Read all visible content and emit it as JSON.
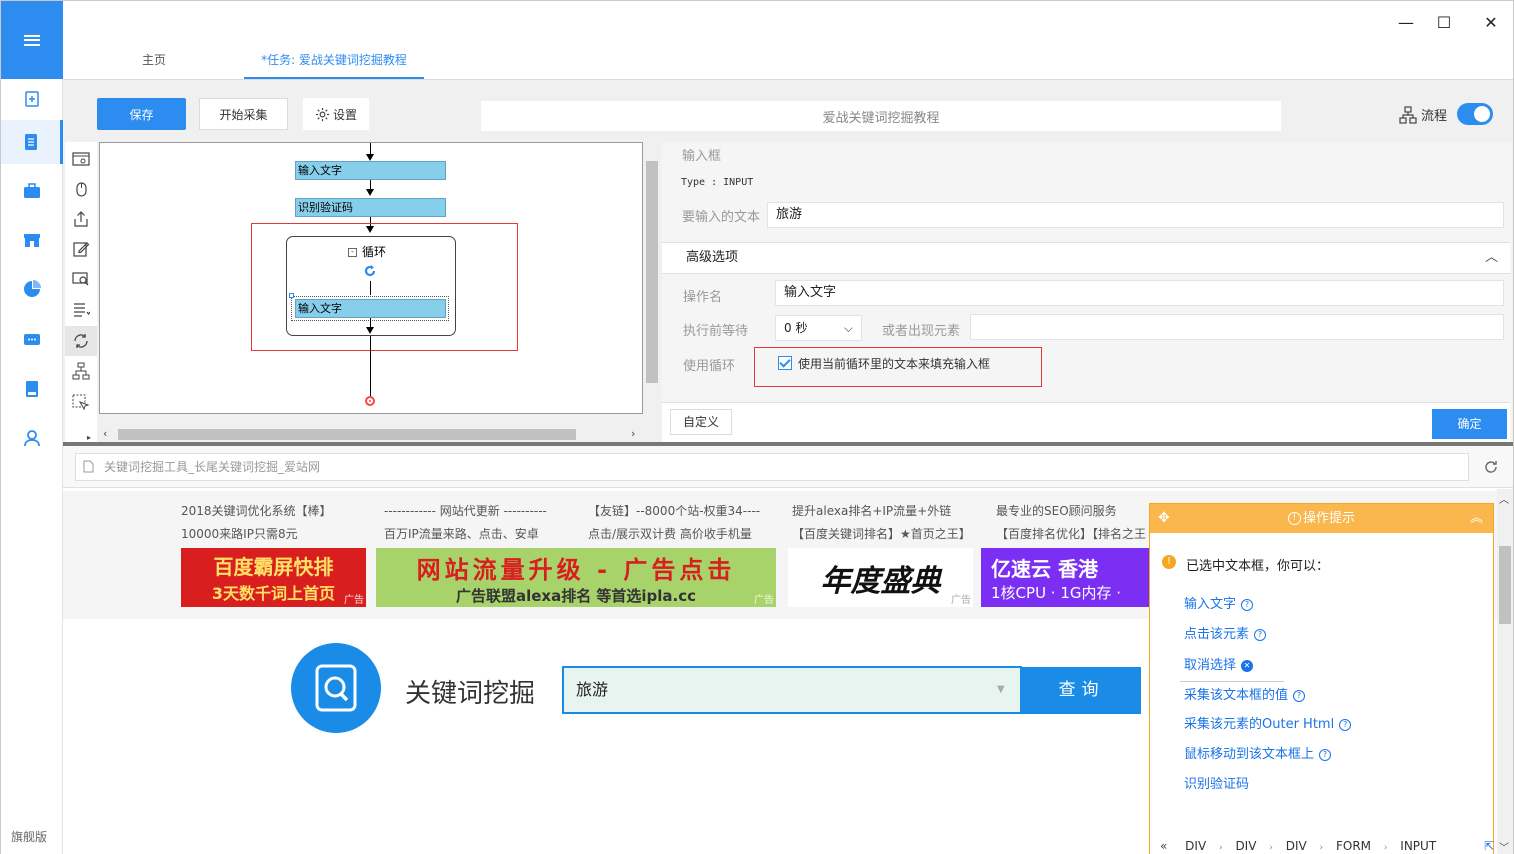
{
  "nav": {
    "edition": "旗舰版"
  },
  "window": {
    "minimize": "—",
    "maximize": "☐",
    "close": "✕"
  },
  "tabs": {
    "home": "主页",
    "task": "*任务: 爱战关键词挖掘教程"
  },
  "toolbar": {
    "save": "保存",
    "start": "开始采集",
    "settings": "设置",
    "task_title": "爱战关键词挖掘教程",
    "flow_label": "流程",
    "flow_enabled": true
  },
  "flow": {
    "node1": "输入文字",
    "node2": "识别验证码",
    "loop_title": "循环",
    "loop_node": "输入文字"
  },
  "props": {
    "section_title": "输入框",
    "type_line": "Type : INPUT",
    "text_label": "要输入的文本",
    "text_value": "旅游",
    "advanced": "高级选项",
    "op_name_label": "操作名",
    "op_name_value": "输入文字",
    "wait_label": "执行前等待",
    "wait_value": "0 秒",
    "or_appear_label": "或者出现元素",
    "use_loop_label": "使用循环",
    "use_loop_checkbox": "使用当前循环里的文本来填充输入框",
    "custom": "自定义",
    "ok": "确定"
  },
  "browser": {
    "address": "关键词挖掘工具_长尾关键词挖掘_爱站网"
  },
  "webpage": {
    "ads": [
      {
        "line1": "2018关键词优化系统【棒】",
        "line2": "10000来路IP只需8元"
      },
      {
        "line1": "------------ 网站代更新 ----------",
        "line2": "百万IP流量来路、点击、安卓"
      },
      {
        "line1": "【友链】--8000个站-权重34----",
        "line2": "点击/展示双计费 高价收手机量"
      },
      {
        "line1": "提升alexa排名+IP流量+外链",
        "line2": "【百度关键词排名】★首页之王】"
      },
      {
        "line1": "最专业的SEO顾问服务",
        "line2": "【百度排名优化】【排名之王"
      }
    ],
    "banners": [
      {
        "line1": "百度霸屏快排",
        "line2": "3天数千词上首页",
        "bg": "#d81e1e",
        "tag": "广告"
      },
      {
        "line1": "网站流量升级 - 广告点击",
        "line2": "广告联盟alexa排名 等首选ipla.cc",
        "bg": "#a7d36a",
        "tag": "广告"
      },
      {
        "line1": "年度盛典",
        "line2": "",
        "bg": "#ffffff",
        "tag": "广告"
      },
      {
        "line1": "亿速云 香港",
        "line2": "1核CPU · 1G内存 ·",
        "bg": "#7b2ff2",
        "tag": ""
      }
    ],
    "site_title": "关键词挖掘",
    "search_value": "旅游",
    "query_button": "查询"
  },
  "tips": {
    "title": "操作提示",
    "intro": "已选中文本框，你可以：",
    "items": [
      "输入文字",
      "点击该元素",
      "取消选择",
      "采集该文本框的值",
      "采集该元素的Outer Html",
      "鼠标移动到该文本框上",
      "识别验证码"
    ],
    "breadcrumb": [
      "DIV",
      "DIV",
      "DIV",
      "FORM",
      "INPUT"
    ]
  },
  "colors": {
    "accent": "#2d8cf0",
    "tips_header": "#f9b74d",
    "node": "#87ceeb",
    "highlight_border": "#e53935"
  }
}
